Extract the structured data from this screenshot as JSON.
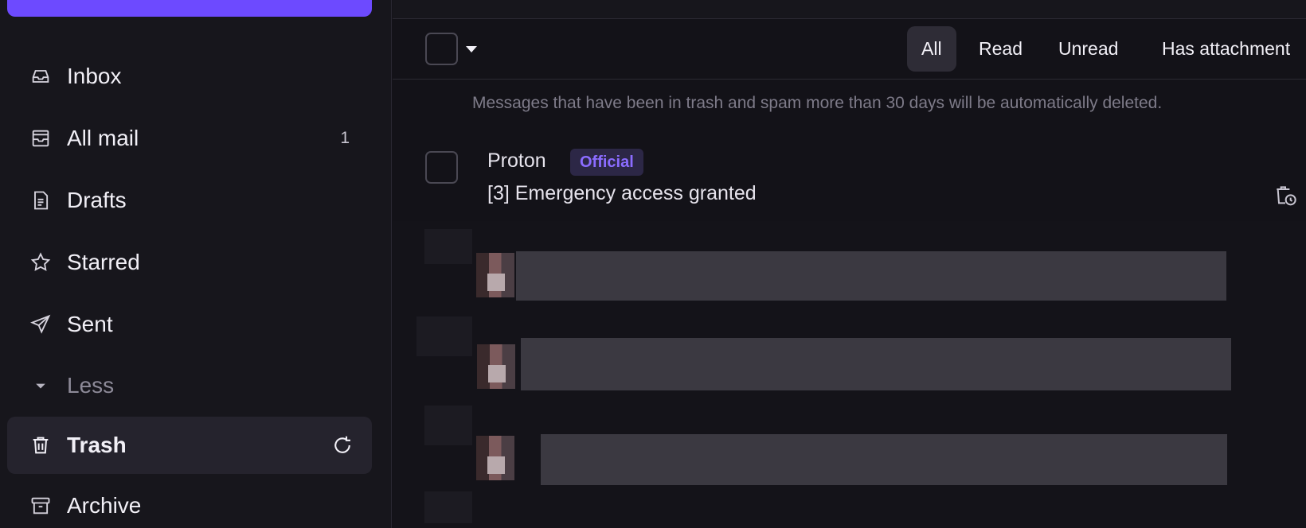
{
  "sidebar": {
    "items": [
      {
        "label": "Inbox",
        "icon": "inbox-icon"
      },
      {
        "label": "All mail",
        "icon": "all-mail-icon",
        "count": "1"
      },
      {
        "label": "Drafts",
        "icon": "drafts-icon"
      },
      {
        "label": "Starred",
        "icon": "star-icon"
      },
      {
        "label": "Sent",
        "icon": "sent-icon"
      },
      {
        "label": "Less",
        "icon": "caret-down-icon"
      },
      {
        "label": "Trash",
        "icon": "trash-icon",
        "active": true
      },
      {
        "label": "Archive",
        "icon": "archive-icon"
      }
    ]
  },
  "toolbar": {
    "filters": [
      "All",
      "Read",
      "Unread",
      "Has attachment"
    ],
    "active_filter": "All"
  },
  "notice": "Messages that have been in trash and spam more than 30 days will be automatically deleted.",
  "messages": [
    {
      "sender": "Proton",
      "badge": "Official",
      "subject": "[3] Emergency access granted"
    }
  ],
  "colors": {
    "accent": "#6d4aff",
    "badge_text": "#8b6cff",
    "background": "#131218",
    "sidebar": "#17161c"
  }
}
